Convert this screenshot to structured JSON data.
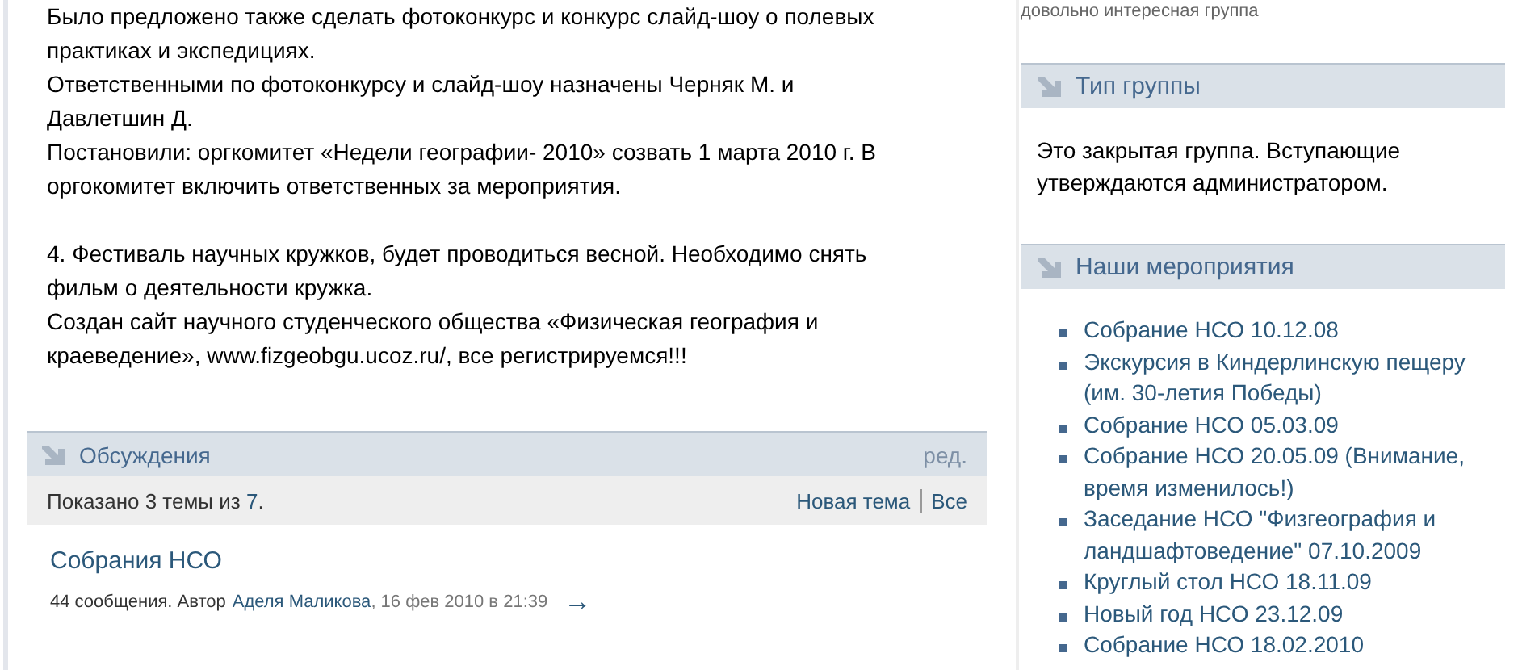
{
  "main": {
    "blocks": [
      {
        "lines": [
          "Было предложено также сделать фотоконкурс и конкурс слайд-шоу о полевых практиках и экспедициях.",
          "Ответственными по фотоконкурсу и слайд-шоу назначены Черняк М. и Давлетшин Д.",
          "Постановили: оргкомитет «Недели географии- 2010» созвать 1 марта 2010 г. В оргокомитет включить ответственных за мероприятия."
        ]
      },
      {
        "lines": [
          "4. Фестиваль научных кружков, будет проводиться весной. Необходимо снять фильм о деятельности кружка.",
          "Создан сайт научного студенческого общества «Физическая география и краеведение», www.fizgeobgu.ucoz.ru/, все регистрируемся!!!"
        ]
      }
    ]
  },
  "discussions": {
    "title": "Обсуждения",
    "edit": "ред.",
    "shown_prefix": "Показано 3 темы из",
    "total": "7",
    "shown_suffix": ".",
    "new_topic": "Новая тема",
    "all": "Все",
    "topics": [
      {
        "title": "Собрания НСО",
        "meta": "44 сообщения. Автор",
        "author": "Аделя Маликова",
        "date": ", 16 фев 2010 в 21:39",
        "arrow": "→"
      }
    ]
  },
  "sidebar": {
    "top_text": "довольно интересная группа",
    "sections": [
      {
        "kind": "text",
        "title": "Тип группы",
        "text": "Это закрытая группа. Вступающие утверждаются администратором."
      },
      {
        "kind": "list",
        "title": "Наши мероприятия",
        "items": [
          "Собрание НСО 10.12.08",
          "Экскурсия в Киндерлинскую пещеру (им. 30-летия Победы)",
          "Собрание НСО 05.03.09",
          "Собрание НСО 20.05.09 (Внимание, время изменилось!)",
          "Заседание НСО \"Физгеография и ландшафтоведение\" 07.10.2009",
          "Круглый стол НСО 18.11.09",
          "Новый год НСО 23.12.09",
          "Собрание НСО 18.02.2010"
        ]
      }
    ]
  }
}
